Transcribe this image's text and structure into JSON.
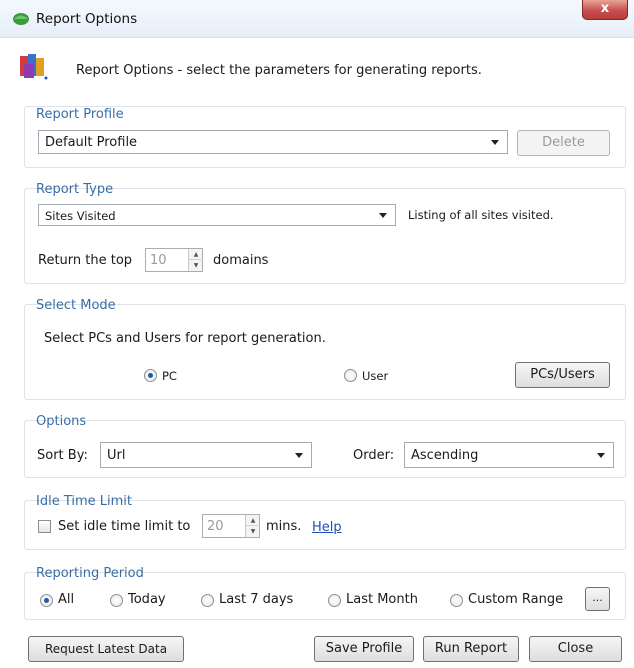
{
  "window": {
    "title": "Report Options",
    "close_label": "x"
  },
  "header": {
    "text": "Report Options - select the parameters for generating reports."
  },
  "report_profile": {
    "group_title": "Report Profile",
    "selected": "Default Profile",
    "delete_label": "Delete"
  },
  "report_type": {
    "group_title": "Report Type",
    "selected": "Sites Visited",
    "description": "Listing of all sites visited.",
    "return_top_label": "Return the top",
    "top_value": "10",
    "domains_label": "domains"
  },
  "select_mode": {
    "group_title": "Select Mode",
    "instruction": "Select PCs and Users for report generation.",
    "pc_label": "PC",
    "user_label": "User",
    "selected": "PC",
    "pcs_users_label": "PCs/Users"
  },
  "options": {
    "group_title": "Options",
    "sort_by_label": "Sort By:",
    "sort_by_value": "Url",
    "order_label": "Order:",
    "order_value": "Ascending"
  },
  "idle_time": {
    "group_title": "Idle Time Limit",
    "checkbox_label": "Set idle time limit to",
    "value": "20",
    "mins_label": "mins.",
    "help_label": "Help",
    "checked": false
  },
  "reporting_period": {
    "group_title": "Reporting Period",
    "options": [
      "All",
      "Today",
      "Last 7 days",
      "Last Month",
      "Custom Range"
    ],
    "selected": "All",
    "browse_label": "..."
  },
  "footer": {
    "request_label": "Request Latest Data",
    "save_label": "Save Profile",
    "run_label": "Run Report",
    "close_label": "Close"
  }
}
